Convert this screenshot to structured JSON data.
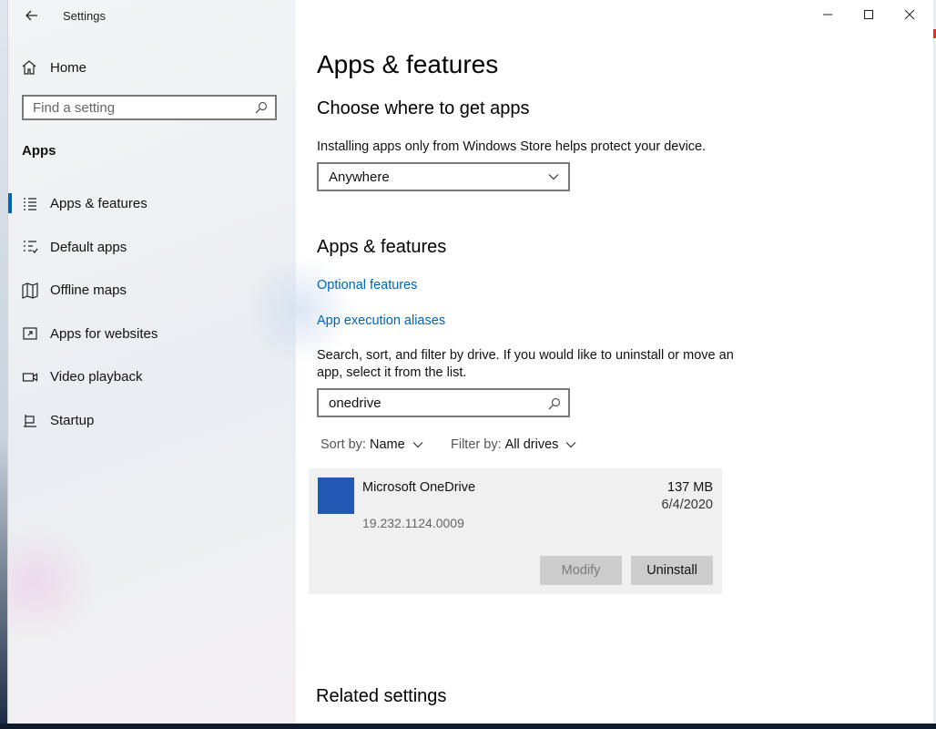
{
  "window": {
    "title": "Settings"
  },
  "sidebar": {
    "home_label": "Home",
    "search_placeholder": "Find a setting",
    "section_title": "Apps",
    "items": [
      {
        "label": "Apps & features",
        "icon": "list-icon",
        "selected": true
      },
      {
        "label": "Default apps",
        "icon": "default-apps-icon",
        "selected": false
      },
      {
        "label": "Offline maps",
        "icon": "map-icon",
        "selected": false
      },
      {
        "label": "Apps for websites",
        "icon": "link-app-icon",
        "selected": false
      },
      {
        "label": "Video playback",
        "icon": "video-icon",
        "selected": false
      },
      {
        "label": "Startup",
        "icon": "startup-icon",
        "selected": false
      }
    ]
  },
  "main": {
    "page_title": "Apps & features",
    "choose_heading": "Choose where to get apps",
    "choose_desc": "Installing apps only from Windows Store helps protect your device.",
    "source_dropdown_value": "Anywhere",
    "features_heading": "Apps & features",
    "optional_features_link": "Optional features",
    "app_aliases_link": "App execution aliases",
    "search_desc_line1": "Search, sort, and filter by drive. If you would like to uninstall or move an",
    "search_desc_line2": "app, select it from the list.",
    "search_value": "onedrive",
    "sort_label": "Sort by:",
    "sort_value": "Name",
    "filter_label": "Filter by:",
    "filter_value": "All drives",
    "app": {
      "name": "Microsoft OneDrive",
      "size": "137 MB",
      "date": "6/4/2020",
      "version": "19.232.1124.0009",
      "modify_label": "Modify",
      "uninstall_label": "Uninstall",
      "icon_color": "#2458b5"
    },
    "related_heading": "Related settings"
  },
  "colors": {
    "accent": "#0063b1"
  }
}
